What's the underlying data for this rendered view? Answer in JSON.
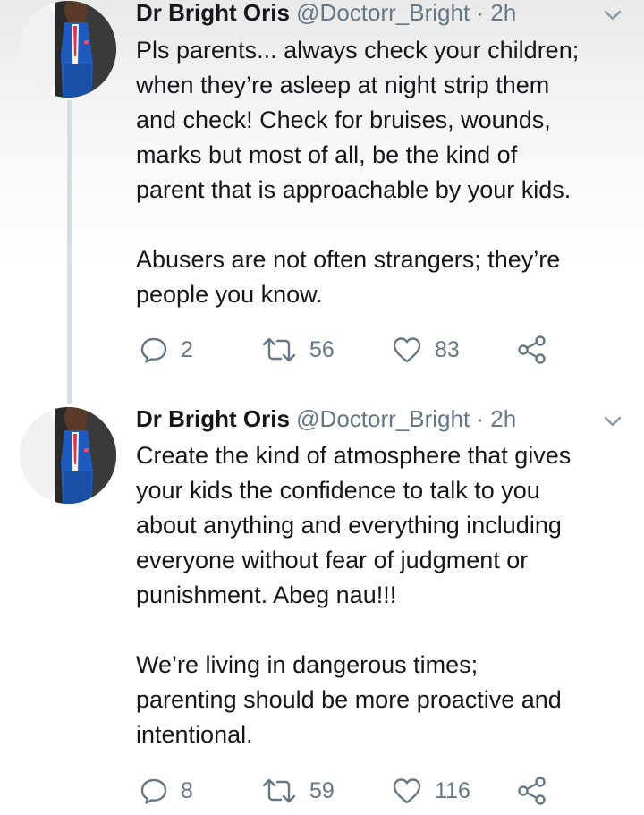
{
  "tweets": [
    {
      "name": "Dr Bright Oris",
      "handle": "@Doctorr_Bright",
      "time": "· 2h",
      "paragraphs": [
        "Pls parents... always check your children;\nwhen they’re asleep at night strip them\nand check! Check for bruises, wounds,\nmarks but most of all, be the kind of\nparent that is approachable by your kids.",
        "Abusers are not often strangers; they’re\npeople you know."
      ],
      "replies": "2",
      "retweets": "56",
      "likes": "83",
      "icons": {
        "reply": "reply-icon",
        "retweet": "retweet-icon",
        "like": "heart-icon",
        "share": "share-icon",
        "menu": "chevron-down-icon"
      }
    },
    {
      "name": "Dr Bright Oris",
      "handle": "@Doctorr_Bright",
      "time": "· 2h",
      "paragraphs": [
        "Create the kind of atmosphere that gives\nyour kids the confidence to talk to you\nabout anything and  everything including\neveryone without fear of judgment or\npunishment. Abeg nau!!!",
        "We’re living in dangerous times;\nparenting should be more proactive and\nintentional."
      ],
      "replies": "8",
      "retweets": "59",
      "likes": "116",
      "icons": {
        "reply": "reply-icon",
        "retweet": "retweet-icon",
        "like": "heart-icon",
        "share": "share-icon",
        "menu": "chevron-down-icon"
      }
    }
  ],
  "colors": {
    "text": "#14171a",
    "secondary": "#657786",
    "thread_line": "#d6dde3",
    "suit": "#1f5bbf"
  }
}
